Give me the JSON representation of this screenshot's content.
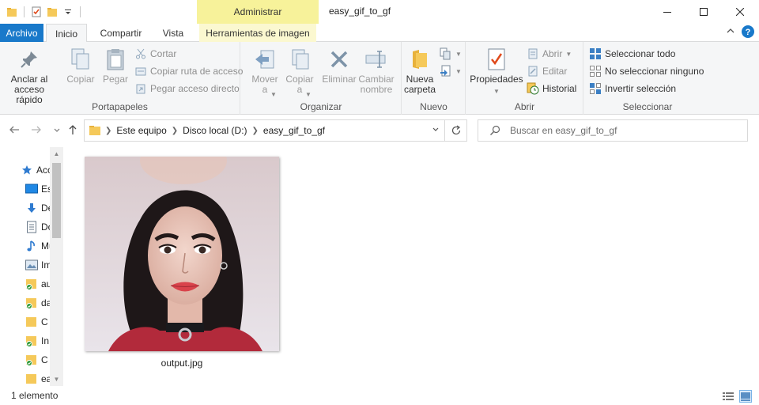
{
  "titlebar": {
    "context_tab_title": "Administrar",
    "window_title": "easy_gif_to_gf"
  },
  "tabs": {
    "file": "Archivo",
    "home": "Inicio",
    "share": "Compartir",
    "view": "Vista",
    "image_tools": "Herramientas de imagen"
  },
  "ribbon": {
    "clipboard": {
      "label": "Portapapeles",
      "pin": "Anclar al\nacceso rápido",
      "copy": "Copiar",
      "paste": "Pegar",
      "cut": "Cortar",
      "copy_path": "Copiar ruta de acceso",
      "paste_shortcut": "Pegar acceso directo"
    },
    "organize": {
      "label": "Organizar",
      "move_to": "Mover\na",
      "copy_to": "Copiar\na",
      "delete": "Eliminar",
      "rename": "Cambiar\nnombre"
    },
    "new": {
      "label": "Nuevo",
      "new_folder": "Nueva\ncarpeta"
    },
    "open": {
      "label": "Abrir",
      "properties": "Propiedades",
      "open": "Abrir",
      "edit": "Editar",
      "history": "Historial"
    },
    "select": {
      "label": "Seleccionar",
      "select_all": "Seleccionar todo",
      "select_none": "No seleccionar ninguno",
      "invert": "Invertir selección"
    }
  },
  "address": {
    "crumbs": [
      "Este equipo",
      "Disco local (D:)",
      "easy_gif_to_gf"
    ],
    "search_placeholder": "Buscar en easy_gif_to_gf"
  },
  "navpane": {
    "items": [
      {
        "label": "Acceso rápido",
        "icon": "star-icon"
      },
      {
        "label": "Escritorio",
        "icon": "desktop-icon"
      },
      {
        "label": "Descargas",
        "icon": "download-icon"
      },
      {
        "label": "Documentos",
        "icon": "document-icon"
      },
      {
        "label": "Música",
        "icon": "music-icon"
      },
      {
        "label": "Imágenes",
        "icon": "pictures-icon"
      },
      {
        "label": "au",
        "icon": "folder-synced-icon"
      },
      {
        "label": "da",
        "icon": "folder-synced-icon"
      },
      {
        "label": "C",
        "icon": "folder-icon"
      },
      {
        "label": "In",
        "icon": "folder-synced-icon"
      },
      {
        "label": "C",
        "icon": "folder-synced-icon"
      },
      {
        "label": "ea",
        "icon": "folder-icon"
      }
    ]
  },
  "files": [
    {
      "name": "output.jpg"
    }
  ],
  "status": {
    "count": "1 elemento"
  },
  "colors": {
    "accent": "#1979ca",
    "context_tab": "#f7f29a"
  }
}
